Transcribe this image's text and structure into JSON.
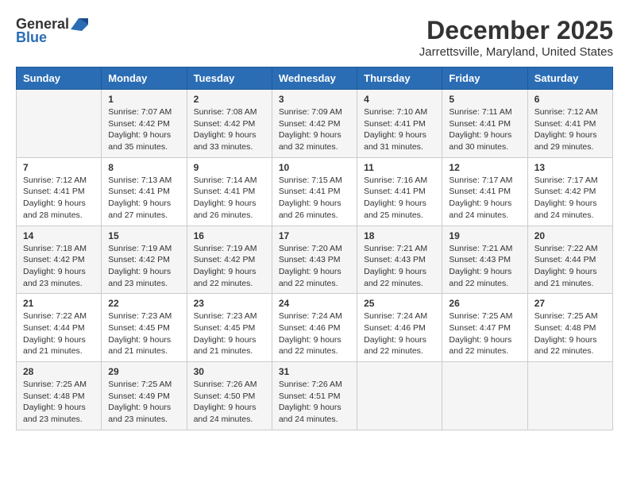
{
  "logo": {
    "general": "General",
    "blue": "Blue"
  },
  "title": "December 2025",
  "subtitle": "Jarrettsville, Maryland, United States",
  "days_header": [
    "Sunday",
    "Monday",
    "Tuesday",
    "Wednesday",
    "Thursday",
    "Friday",
    "Saturday"
  ],
  "weeks": [
    [
      {
        "day": "",
        "sunrise": "",
        "sunset": "",
        "daylight": ""
      },
      {
        "day": "1",
        "sunrise": "Sunrise: 7:07 AM",
        "sunset": "Sunset: 4:42 PM",
        "daylight": "Daylight: 9 hours and 35 minutes."
      },
      {
        "day": "2",
        "sunrise": "Sunrise: 7:08 AM",
        "sunset": "Sunset: 4:42 PM",
        "daylight": "Daylight: 9 hours and 33 minutes."
      },
      {
        "day": "3",
        "sunrise": "Sunrise: 7:09 AM",
        "sunset": "Sunset: 4:42 PM",
        "daylight": "Daylight: 9 hours and 32 minutes."
      },
      {
        "day": "4",
        "sunrise": "Sunrise: 7:10 AM",
        "sunset": "Sunset: 4:41 PM",
        "daylight": "Daylight: 9 hours and 31 minutes."
      },
      {
        "day": "5",
        "sunrise": "Sunrise: 7:11 AM",
        "sunset": "Sunset: 4:41 PM",
        "daylight": "Daylight: 9 hours and 30 minutes."
      },
      {
        "day": "6",
        "sunrise": "Sunrise: 7:12 AM",
        "sunset": "Sunset: 4:41 PM",
        "daylight": "Daylight: 9 hours and 29 minutes."
      }
    ],
    [
      {
        "day": "7",
        "sunrise": "Sunrise: 7:12 AM",
        "sunset": "Sunset: 4:41 PM",
        "daylight": "Daylight: 9 hours and 28 minutes."
      },
      {
        "day": "8",
        "sunrise": "Sunrise: 7:13 AM",
        "sunset": "Sunset: 4:41 PM",
        "daylight": "Daylight: 9 hours and 27 minutes."
      },
      {
        "day": "9",
        "sunrise": "Sunrise: 7:14 AM",
        "sunset": "Sunset: 4:41 PM",
        "daylight": "Daylight: 9 hours and 26 minutes."
      },
      {
        "day": "10",
        "sunrise": "Sunrise: 7:15 AM",
        "sunset": "Sunset: 4:41 PM",
        "daylight": "Daylight: 9 hours and 26 minutes."
      },
      {
        "day": "11",
        "sunrise": "Sunrise: 7:16 AM",
        "sunset": "Sunset: 4:41 PM",
        "daylight": "Daylight: 9 hours and 25 minutes."
      },
      {
        "day": "12",
        "sunrise": "Sunrise: 7:17 AM",
        "sunset": "Sunset: 4:41 PM",
        "daylight": "Daylight: 9 hours and 24 minutes."
      },
      {
        "day": "13",
        "sunrise": "Sunrise: 7:17 AM",
        "sunset": "Sunset: 4:42 PM",
        "daylight": "Daylight: 9 hours and 24 minutes."
      }
    ],
    [
      {
        "day": "14",
        "sunrise": "Sunrise: 7:18 AM",
        "sunset": "Sunset: 4:42 PM",
        "daylight": "Daylight: 9 hours and 23 minutes."
      },
      {
        "day": "15",
        "sunrise": "Sunrise: 7:19 AM",
        "sunset": "Sunset: 4:42 PM",
        "daylight": "Daylight: 9 hours and 23 minutes."
      },
      {
        "day": "16",
        "sunrise": "Sunrise: 7:19 AM",
        "sunset": "Sunset: 4:42 PM",
        "daylight": "Daylight: 9 hours and 22 minutes."
      },
      {
        "day": "17",
        "sunrise": "Sunrise: 7:20 AM",
        "sunset": "Sunset: 4:43 PM",
        "daylight": "Daylight: 9 hours and 22 minutes."
      },
      {
        "day": "18",
        "sunrise": "Sunrise: 7:21 AM",
        "sunset": "Sunset: 4:43 PM",
        "daylight": "Daylight: 9 hours and 22 minutes."
      },
      {
        "day": "19",
        "sunrise": "Sunrise: 7:21 AM",
        "sunset": "Sunset: 4:43 PM",
        "daylight": "Daylight: 9 hours and 22 minutes."
      },
      {
        "day": "20",
        "sunrise": "Sunrise: 7:22 AM",
        "sunset": "Sunset: 4:44 PM",
        "daylight": "Daylight: 9 hours and 21 minutes."
      }
    ],
    [
      {
        "day": "21",
        "sunrise": "Sunrise: 7:22 AM",
        "sunset": "Sunset: 4:44 PM",
        "daylight": "Daylight: 9 hours and 21 minutes."
      },
      {
        "day": "22",
        "sunrise": "Sunrise: 7:23 AM",
        "sunset": "Sunset: 4:45 PM",
        "daylight": "Daylight: 9 hours and 21 minutes."
      },
      {
        "day": "23",
        "sunrise": "Sunrise: 7:23 AM",
        "sunset": "Sunset: 4:45 PM",
        "daylight": "Daylight: 9 hours and 21 minutes."
      },
      {
        "day": "24",
        "sunrise": "Sunrise: 7:24 AM",
        "sunset": "Sunset: 4:46 PM",
        "daylight": "Daylight: 9 hours and 22 minutes."
      },
      {
        "day": "25",
        "sunrise": "Sunrise: 7:24 AM",
        "sunset": "Sunset: 4:46 PM",
        "daylight": "Daylight: 9 hours and 22 minutes."
      },
      {
        "day": "26",
        "sunrise": "Sunrise: 7:25 AM",
        "sunset": "Sunset: 4:47 PM",
        "daylight": "Daylight: 9 hours and 22 minutes."
      },
      {
        "day": "27",
        "sunrise": "Sunrise: 7:25 AM",
        "sunset": "Sunset: 4:48 PM",
        "daylight": "Daylight: 9 hours and 22 minutes."
      }
    ],
    [
      {
        "day": "28",
        "sunrise": "Sunrise: 7:25 AM",
        "sunset": "Sunset: 4:48 PM",
        "daylight": "Daylight: 9 hours and 23 minutes."
      },
      {
        "day": "29",
        "sunrise": "Sunrise: 7:25 AM",
        "sunset": "Sunset: 4:49 PM",
        "daylight": "Daylight: 9 hours and 23 minutes."
      },
      {
        "day": "30",
        "sunrise": "Sunrise: 7:26 AM",
        "sunset": "Sunset: 4:50 PM",
        "daylight": "Daylight: 9 hours and 24 minutes."
      },
      {
        "day": "31",
        "sunrise": "Sunrise: 7:26 AM",
        "sunset": "Sunset: 4:51 PM",
        "daylight": "Daylight: 9 hours and 24 minutes."
      },
      {
        "day": "",
        "sunrise": "",
        "sunset": "",
        "daylight": ""
      },
      {
        "day": "",
        "sunrise": "",
        "sunset": "",
        "daylight": ""
      },
      {
        "day": "",
        "sunrise": "",
        "sunset": "",
        "daylight": ""
      }
    ]
  ]
}
